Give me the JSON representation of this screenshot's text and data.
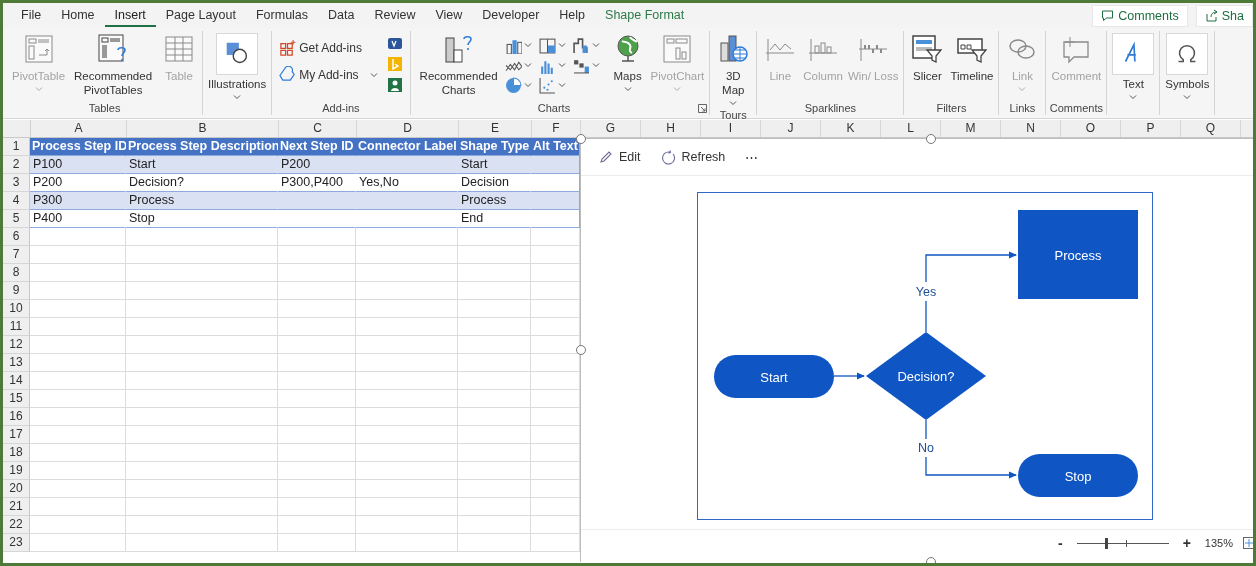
{
  "tabs": [
    {
      "label": "File",
      "selected": false,
      "kind": "normal"
    },
    {
      "label": "Home",
      "selected": false,
      "kind": "normal"
    },
    {
      "label": "Insert",
      "selected": true,
      "kind": "normal"
    },
    {
      "label": "Page Layout",
      "selected": false,
      "kind": "normal"
    },
    {
      "label": "Formulas",
      "selected": false,
      "kind": "normal"
    },
    {
      "label": "Data",
      "selected": false,
      "kind": "normal"
    },
    {
      "label": "Review",
      "selected": false,
      "kind": "normal"
    },
    {
      "label": "View",
      "selected": false,
      "kind": "normal"
    },
    {
      "label": "Developer",
      "selected": false,
      "kind": "normal"
    },
    {
      "label": "Help",
      "selected": false,
      "kind": "normal"
    },
    {
      "label": "Shape Format",
      "selected": false,
      "kind": "contextual"
    }
  ],
  "header_buttons": [
    {
      "label": "Comments",
      "kind": "comments"
    },
    {
      "label": "Sha",
      "kind": "share"
    }
  ],
  "ribbon_groups": [
    {
      "label": "Tables",
      "items": [
        {
          "kind": "large",
          "label": "PivotTable",
          "disabled": true,
          "dropdown": true
        },
        {
          "kind": "large",
          "label": "Recommended PivotTables",
          "disabled": false,
          "dropdown": false
        },
        {
          "kind": "large",
          "label": "Table",
          "disabled": true,
          "dropdown": false
        }
      ]
    },
    {
      "items": [
        {
          "kind": "boxed",
          "label": "Illustrations",
          "disabled": false,
          "dropdown": true
        }
      ]
    },
    {
      "label": "Add-ins",
      "items": [
        {
          "kind": "small",
          "label": "Get Add-ins",
          "disabled": false,
          "dropdown": false
        },
        {
          "kind": "small",
          "label": "My Add-ins",
          "disabled": false,
          "dropdown": true
        },
        {
          "kind": "app"
        },
        {
          "kind": "app"
        },
        {
          "kind": "app"
        }
      ]
    },
    {
      "label": "Charts",
      "dialog_launcher": true,
      "items": [
        {
          "kind": "large",
          "label": "Recommended Charts",
          "disabled": false,
          "dropdown": false
        },
        {
          "kind": "chart_menu"
        },
        {
          "kind": "chart_menu"
        },
        {
          "kind": "chart_menu"
        },
        {
          "kind": "chart_menu"
        },
        {
          "kind": "chart_menu"
        },
        {
          "kind": "chart_menu"
        },
        {
          "kind": "chart_menu"
        },
        {
          "kind": "chart_menu"
        },
        {
          "kind": "large",
          "label": "Maps",
          "disabled": false,
          "dropdown": true
        },
        {
          "kind": "large",
          "label": "PivotChart",
          "disabled": true,
          "dropdown": true
        }
      ]
    },
    {
      "label": "Tours",
      "items": [
        {
          "kind": "large",
          "label": "3D Map",
          "disabled": false,
          "dropdown": true
        }
      ]
    },
    {
      "label": "Sparklines",
      "items": [
        {
          "kind": "large",
          "label": "Line",
          "disabled": true,
          "dropdown": false
        },
        {
          "kind": "large",
          "label": "Column",
          "disabled": true,
          "dropdown": false
        },
        {
          "kind": "large",
          "label": "Win/ Loss",
          "disabled": true,
          "dropdown": false
        }
      ]
    },
    {
      "label": "Filters",
      "items": [
        {
          "kind": "large",
          "label": "Slicer",
          "disabled": false,
          "dropdown": false
        },
        {
          "kind": "large",
          "label": "Timeline",
          "disabled": false,
          "dropdown": false
        }
      ]
    },
    {
      "label": "Links",
      "items": [
        {
          "kind": "large",
          "label": "Link",
          "disabled": true,
          "dropdown": true
        }
      ]
    },
    {
      "label": "Comments",
      "items": [
        {
          "kind": "large",
          "label": "Comment",
          "disabled": true,
          "dropdown": false
        }
      ]
    },
    {
      "items": [
        {
          "kind": "boxed",
          "label": "Text",
          "disabled": false,
          "dropdown": true
        }
      ]
    },
    {
      "items": [
        {
          "kind": "boxed",
          "label": "Symbols",
          "disabled": false,
          "dropdown": true
        }
      ]
    }
  ],
  "sheet": {
    "columns": [
      "A",
      "B",
      "C",
      "D",
      "E",
      "F",
      "G",
      "H",
      "I",
      "J",
      "K",
      "L",
      "M",
      "N",
      "O",
      "P",
      "Q"
    ],
    "rows": [
      {
        "number": "1",
        "kind": "table_header",
        "cells": {
          "A": "Process Step ID",
          "B": "Process Step Description",
          "C": "Next Step ID",
          "D": "Connector Label",
          "E": "Shape Type",
          "F": "Alt Text"
        }
      },
      {
        "number": "2",
        "kind": "table_band",
        "cells": {
          "A": "P100",
          "B": "Start",
          "C": "P200",
          "E": "Start"
        }
      },
      {
        "number": "3",
        "kind": "table_row",
        "cells": {
          "A": "P200",
          "B": "Decision?",
          "C": "P300,P400",
          "D": "Yes,No",
          "E": "Decision"
        }
      },
      {
        "number": "4",
        "kind": "table_band",
        "cells": {
          "A": "P300",
          "B": "Process",
          "E": "Process"
        }
      },
      {
        "number": "5",
        "kind": "table_row",
        "cells": {
          "A": "P400",
          "B": "Stop",
          "E": "End"
        }
      },
      {
        "number": "6",
        "kind": "empty"
      },
      {
        "number": "7",
        "kind": "empty"
      },
      {
        "number": "8",
        "kind": "empty"
      },
      {
        "number": "9",
        "kind": "empty"
      },
      {
        "number": "10",
        "kind": "empty"
      },
      {
        "number": "11",
        "kind": "empty"
      },
      {
        "number": "12",
        "kind": "empty"
      },
      {
        "number": "13",
        "kind": "empty"
      },
      {
        "number": "14",
        "kind": "empty"
      },
      {
        "number": "15",
        "kind": "empty"
      },
      {
        "number": "16",
        "kind": "empty"
      },
      {
        "number": "17",
        "kind": "empty"
      },
      {
        "number": "18",
        "kind": "empty"
      },
      {
        "number": "19",
        "kind": "empty"
      },
      {
        "number": "20",
        "kind": "empty"
      },
      {
        "number": "21",
        "kind": "empty"
      },
      {
        "number": "22",
        "kind": "empty"
      },
      {
        "number": "23",
        "kind": "empty"
      }
    ]
  },
  "diagram_panel": {
    "toolbar": [
      {
        "label": "Edit",
        "kind": "edit"
      },
      {
        "label": "Refresh",
        "kind": "refresh"
      },
      {
        "label": "⋯",
        "kind": "more"
      }
    ],
    "nodes": [
      {
        "kind": "terminator",
        "label": "Start"
      },
      {
        "kind": "decision",
        "label": "Decision?"
      },
      {
        "kind": "process",
        "label": "Process"
      },
      {
        "kind": "terminator",
        "label": "Stop"
      }
    ],
    "connector_labels": [
      "Yes",
      "No"
    ],
    "zoom": {
      "out": "-",
      "in": "+",
      "level": 0.32,
      "reading": "135%"
    }
  }
}
